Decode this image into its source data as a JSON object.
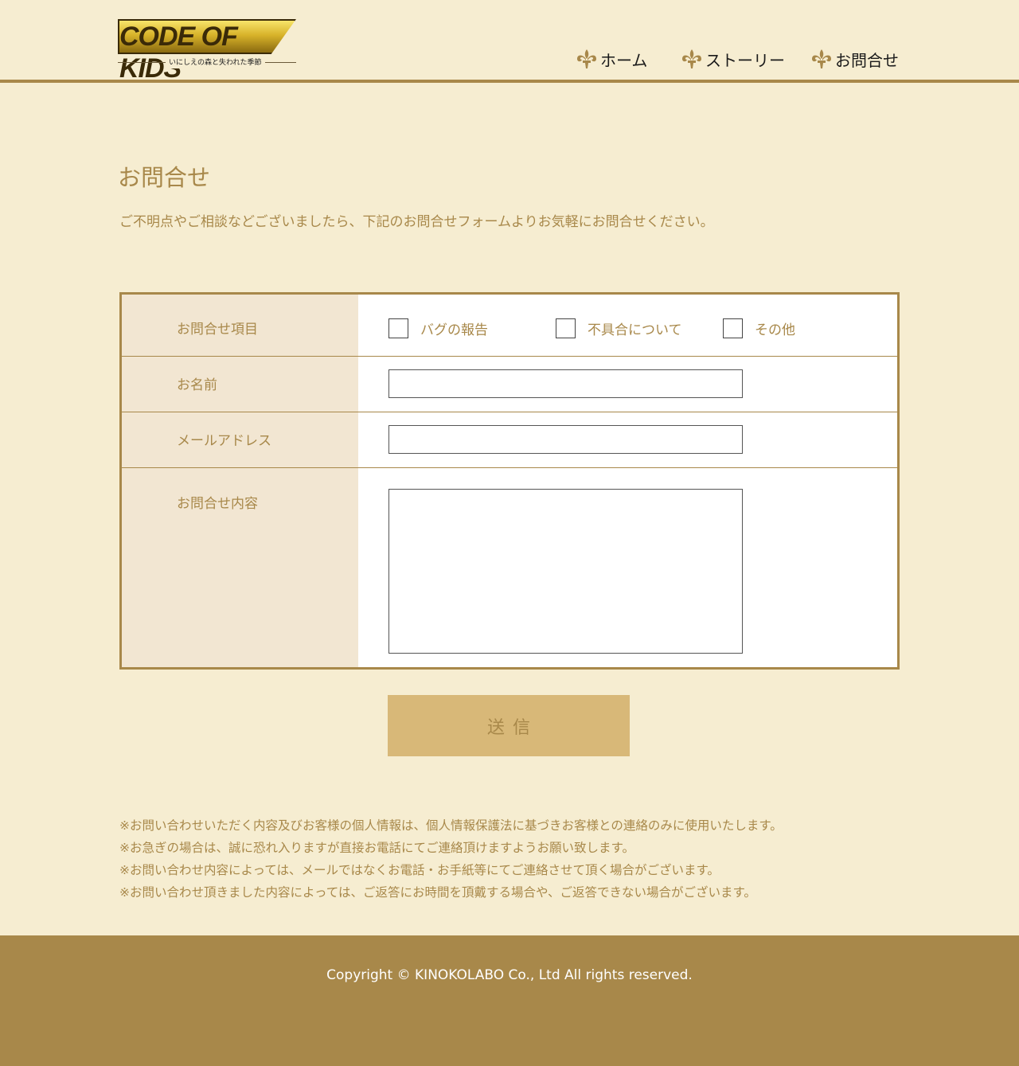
{
  "header": {
    "logo_text": "CODE OF KIDS",
    "logo_subtitle": "いにしえの森と失われた季節",
    "nav": [
      {
        "label": "ホーム",
        "icon": "fleur-de-lis-icon"
      },
      {
        "label": "ストーリー",
        "icon": "fleur-de-lis-icon"
      },
      {
        "label": "お問合せ",
        "icon": "fleur-de-lis-icon"
      }
    ]
  },
  "page": {
    "title": "お問合せ",
    "description": "ご不明点やご相談などございましたら、下記のお問合せフォームよりお気軽にお問合せください。"
  },
  "form": {
    "category_label": "お問合せ項目",
    "categories": [
      {
        "label": "バグの報告",
        "checked": false
      },
      {
        "label": "不具合について",
        "checked": false
      },
      {
        "label": "その他",
        "checked": false
      }
    ],
    "name_label": "お名前",
    "name_value": "",
    "email_label": "メールアドレス",
    "email_value": "",
    "message_label": "お問合せ内容",
    "message_value": "",
    "submit_label": "送信"
  },
  "notes": [
    "※お問い合わせいただく内容及びお客様の個人情報は、個人情報保護法に基づきお客様との連絡のみに使用いたします。",
    "※お急ぎの場合は、誠に恐れ入りますが直接お電話にてご連絡頂けますようお願い致します。",
    "※お問い合わせ内容によっては、メールではなくお電話・お手紙等にてご連絡させて頂く場合がございます。",
    "※お問い合わせ頂きました内容によっては、ご返答にお時間を頂戴する場合や、ご返答できない場合がございます。"
  ],
  "footer": {
    "copyright": "Copyright © KINOKOLABO Co., Ltd All rights reserved."
  },
  "colors": {
    "background": "#f6edd1",
    "accent": "#a8884a",
    "label_cell": "#f2e6d2",
    "button": "#d8b878"
  }
}
